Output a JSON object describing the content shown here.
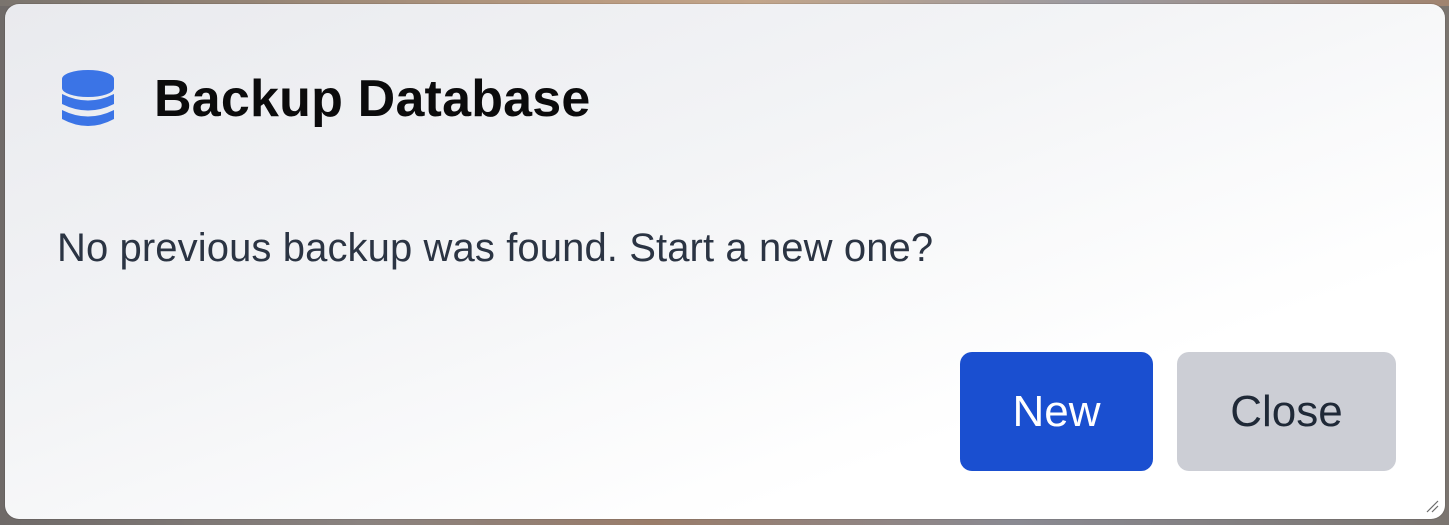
{
  "dialog": {
    "title": "Backup Database",
    "icon": "database-icon",
    "message": "No previous backup was found. Start a new one?",
    "buttons": {
      "new_label": "New",
      "close_label": "Close"
    }
  },
  "colors": {
    "accent": "#1a4fd0",
    "icon": "#3b74e6",
    "secondary_button": "#ccced5",
    "title_text": "#0b0b0c",
    "body_text": "#2b3443"
  }
}
